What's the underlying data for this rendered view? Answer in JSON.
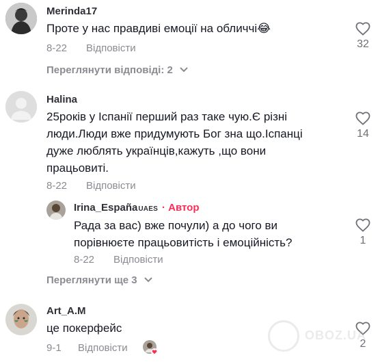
{
  "comments": [
    {
      "username": "Merinda17",
      "text": "Проте у нас правдиві емоції на обличчі😂",
      "date": "8-22",
      "reply_label": "Відповісти",
      "likes": "32",
      "view_replies": "Переглянути відповіді: 2"
    },
    {
      "username": "Halina",
      "text_lines": [
        "25років у Іспанії перший раз таке чую.Є різні",
        "люди.Люди вже придумують Бог зна що.Іспанці",
        "дуже люблять українців,кажуть ,що вони",
        "працьовиті."
      ],
      "date": "8-22",
      "reply_label": "Відповісти",
      "likes": "14",
      "reply": {
        "username": "Irina_España",
        "tag": "UAES",
        "author_badge": "· Автор",
        "text_lines": [
          "Рада за вас) вже почули) а до чого ви",
          "порівнюєте працьовитість і емоційність?"
        ],
        "date": "8-22",
        "reply_label": "Відповісти",
        "likes": "1"
      },
      "view_more": "Переглянути ще 3"
    },
    {
      "username": "Art_A.M",
      "text": "це покерфейс",
      "date": "9-1",
      "reply_label": "Відповісти",
      "likes": "2"
    }
  ],
  "watermark": "OBOZ.UA",
  "colors": {
    "accent": "#fe2c55",
    "muted": "#8a8b91",
    "text": "#161823"
  }
}
